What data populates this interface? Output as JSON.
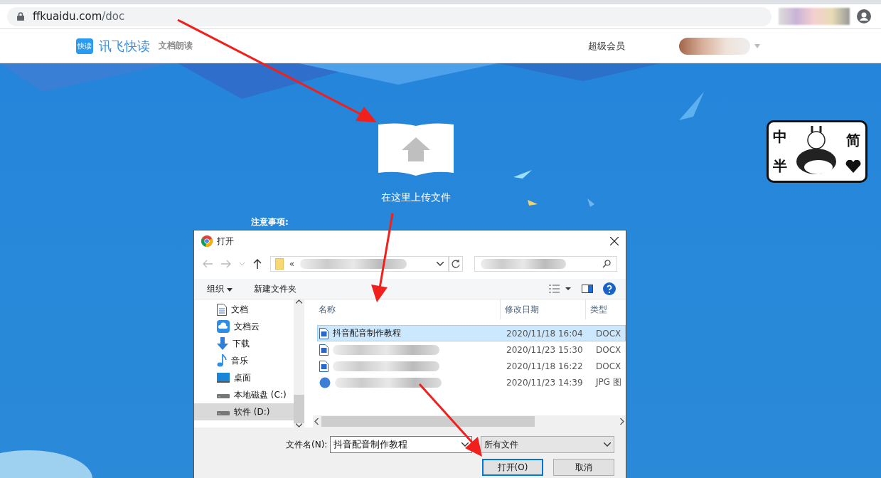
{
  "browser": {
    "url_host": "ffkuaidu.com",
    "url_path": "/doc"
  },
  "site_header": {
    "logo_badge": "快读",
    "brand": "讯飞快读",
    "tagline": "文档朗读",
    "nav_link": "超级会员"
  },
  "upload": {
    "label": "在这里上传文件",
    "notice_title": "注意事项:"
  },
  "ime_bar": {
    "chars": [
      "中",
      "半",
      "简"
    ]
  },
  "dialog": {
    "title": "打开",
    "path_prefix": "«",
    "toolbar": {
      "organize": "组织",
      "new_folder": "新建文件夹"
    },
    "nav_items": [
      {
        "label": "文档",
        "kind": "document",
        "selected": false
      },
      {
        "label": "文档云",
        "kind": "cloud",
        "selected": false
      },
      {
        "label": "下载",
        "kind": "download",
        "selected": false
      },
      {
        "label": "音乐",
        "kind": "music",
        "selected": false
      },
      {
        "label": "桌面",
        "kind": "desktop",
        "selected": false
      },
      {
        "label": "本地磁盘 (C:)",
        "kind": "drive",
        "selected": false
      },
      {
        "label": "软件 (D:)",
        "kind": "drive",
        "selected": true
      }
    ],
    "columns": [
      "名称",
      "修改日期",
      "类型"
    ],
    "files": [
      {
        "name": "抖音配音制作教程",
        "date": "2020/11/18 16:04",
        "type": "DOCX",
        "kind": "word",
        "selected": true
      },
      {
        "date": "2020/11/23 15:30",
        "type": "DOCX",
        "kind": "word",
        "selected": false
      },
      {
        "date": "2020/11/18 16:22",
        "type": "DOCX",
        "kind": "word",
        "selected": false
      },
      {
        "date": "2020/11/23 14:39",
        "type": "JPG 图",
        "kind": "jpg",
        "selected": false
      }
    ],
    "filename_label": "文件名(N):",
    "filename_value": "抖音配音制作教程",
    "filter": "所有文件",
    "buttons": [
      {
        "label": "打开(O)",
        "kind": "primary"
      },
      {
        "label": "取消",
        "kind": "normal"
      }
    ]
  }
}
